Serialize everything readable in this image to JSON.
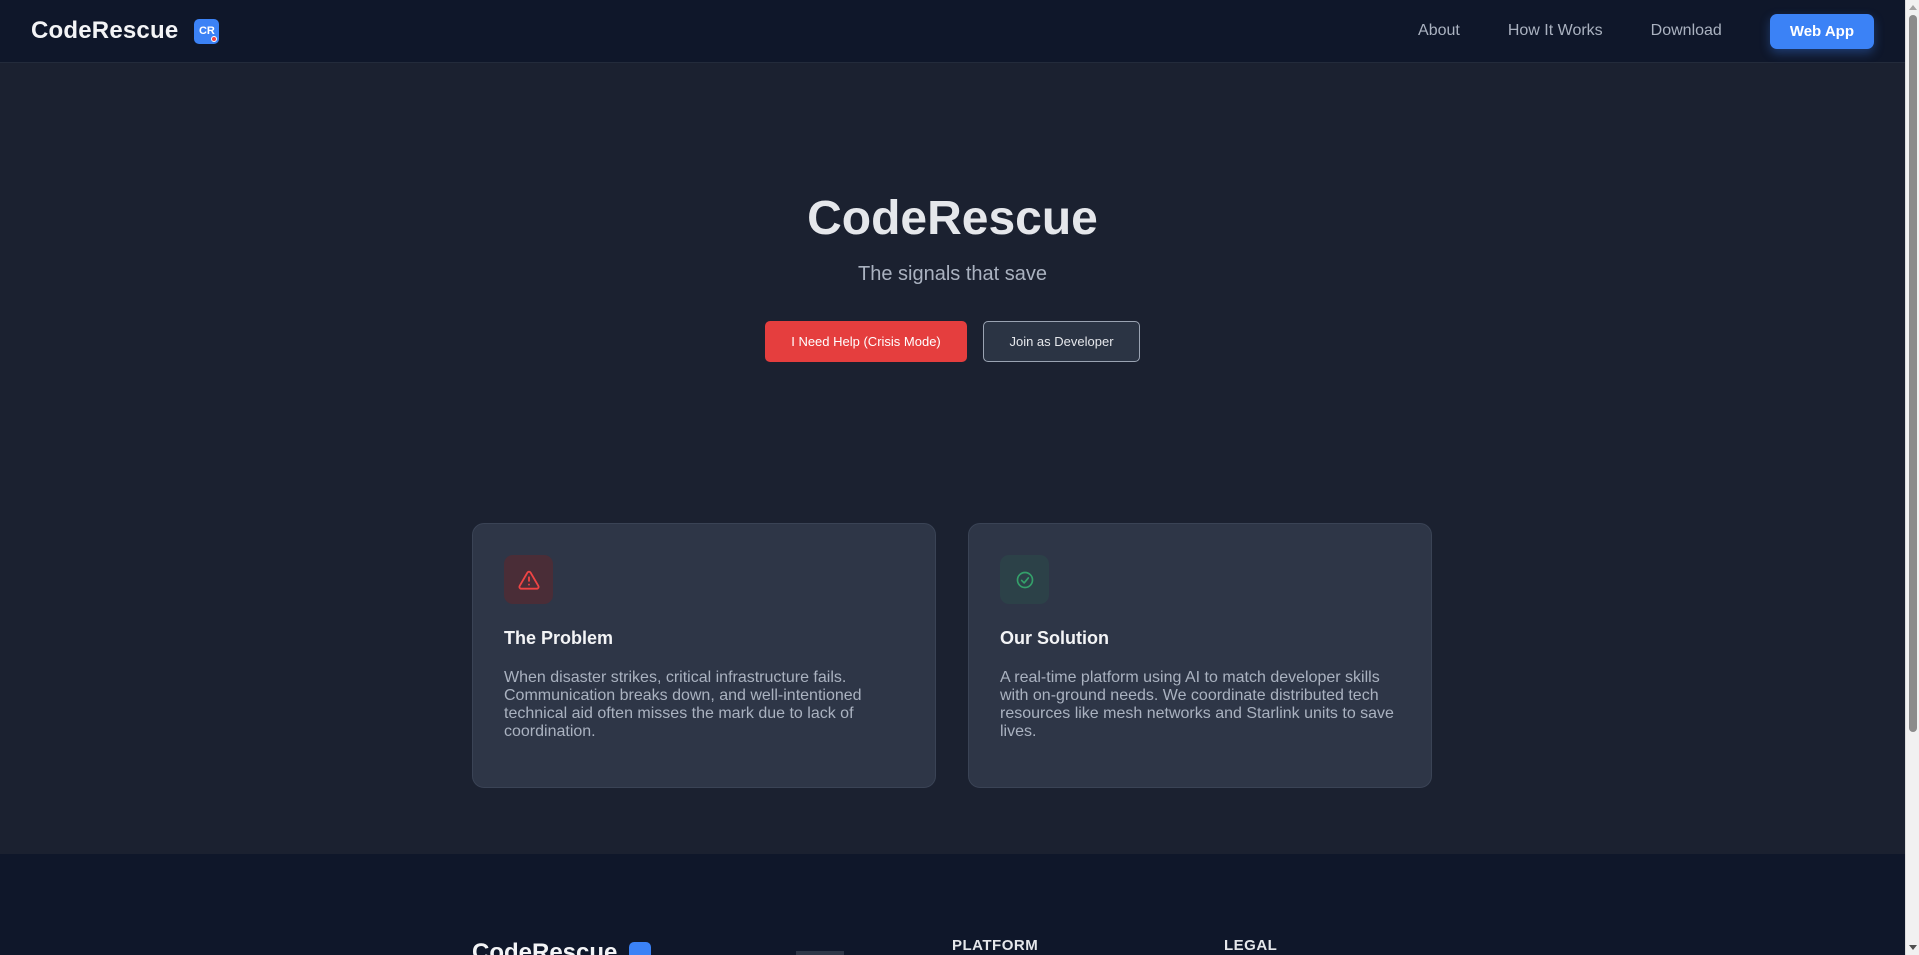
{
  "navbar": {
    "brand": "CodeRescue",
    "badge": "CR",
    "links": [
      "About",
      "How It Works",
      "Download"
    ],
    "cta": "Web App"
  },
  "hero": {
    "title": "CodeRescue",
    "subtitle": "The signals that save",
    "primary_button": "I Need Help (Crisis Mode)",
    "secondary_button": "Join as Developer"
  },
  "cards": [
    {
      "icon": "warning-triangle-icon",
      "title": "The Problem",
      "text": "When disaster strikes, critical infrastructure fails. Communication breaks down, and well-intentioned technical aid often misses the mark due to lack of coordination."
    },
    {
      "icon": "check-circle-icon",
      "title": "Our Solution",
      "text": "A real-time platform using AI to match developer skills with on-ground needs. We coordinate distributed tech resources like mesh networks and Starlink units to save lives."
    }
  ],
  "footer": {
    "brand": "CodeRescue",
    "columns": [
      "PLATFORM",
      "LEGAL"
    ]
  },
  "colors": {
    "accent": "#3b82f6",
    "danger": "#e53e3e",
    "success": "#34a06a",
    "background": "#1b2130",
    "navbar": "#0f172a",
    "card": "#2e3647"
  }
}
